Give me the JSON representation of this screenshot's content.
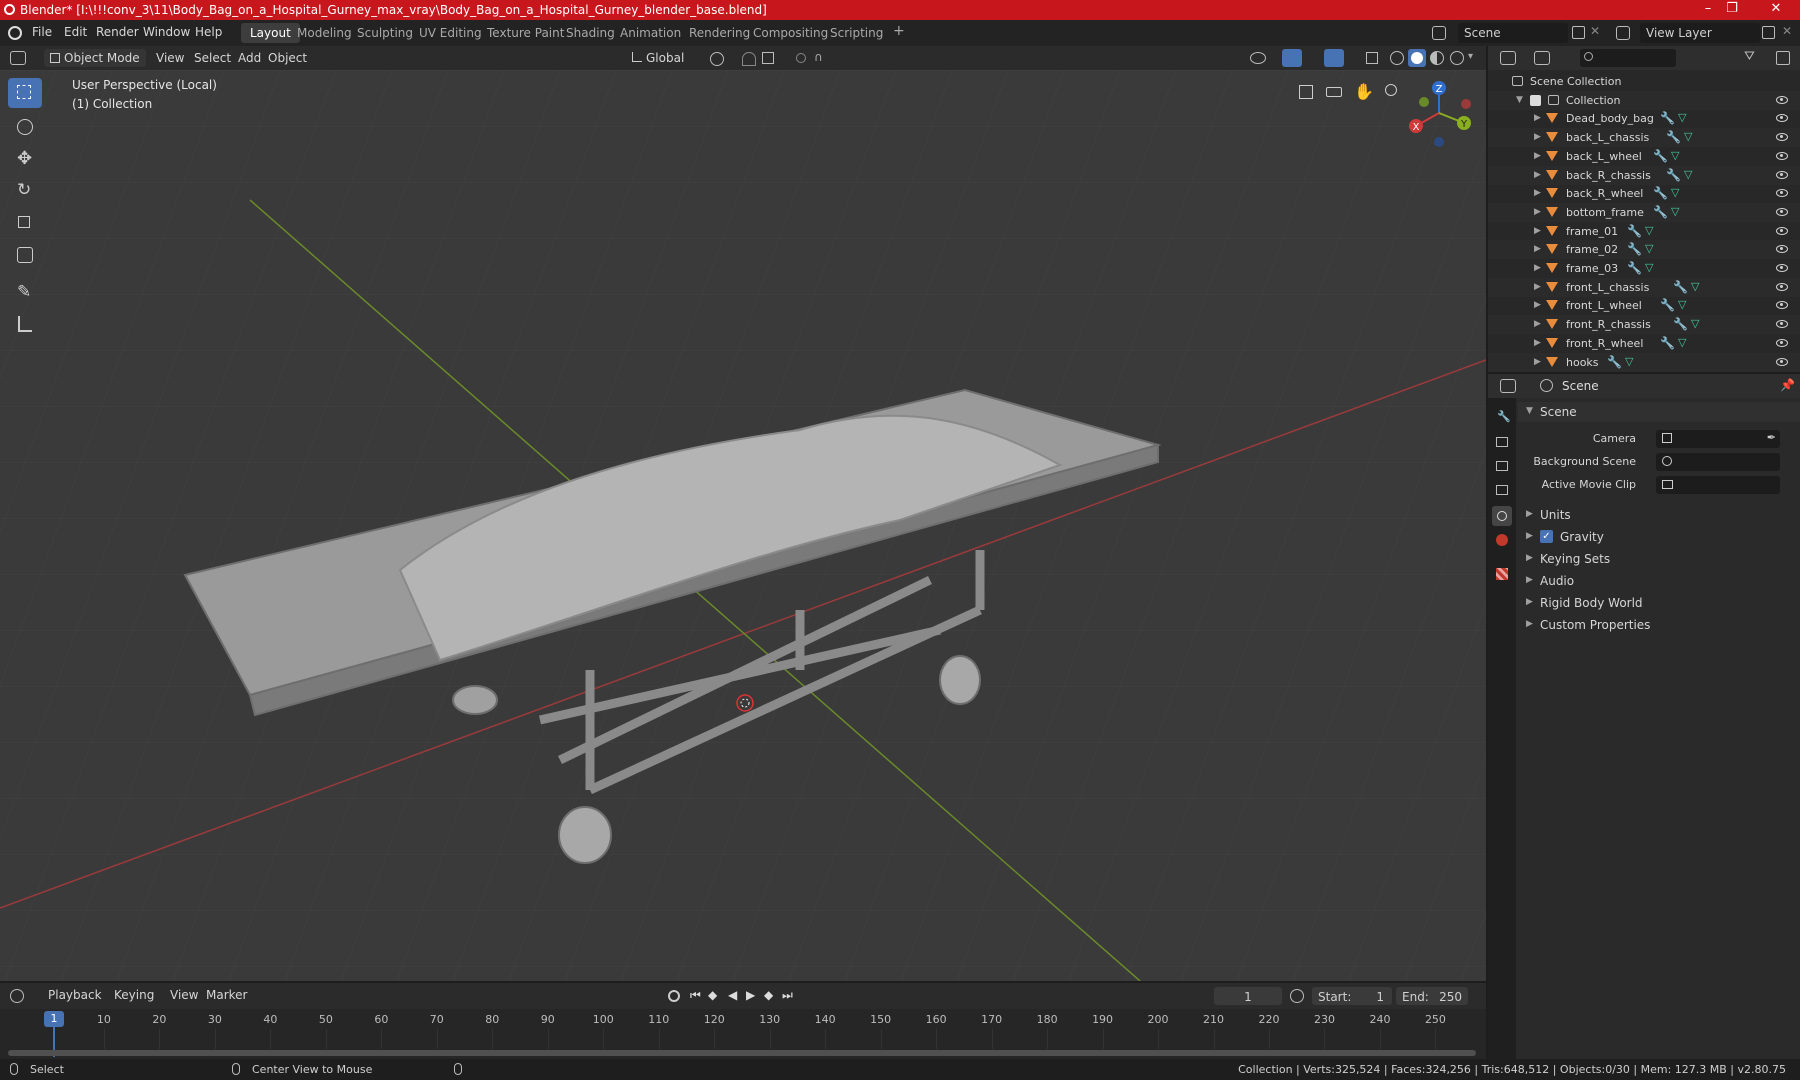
{
  "window": {
    "title": "Blender* [I:\\!!!conv_3\\11\\Body_Bag_on_a_Hospital_Gurney_max_vray\\Body_Bag_on_a_Hospital_Gurney_blender_base.blend]",
    "minimize": "–",
    "maximize": "❐",
    "close": "✕"
  },
  "menu": {
    "items": [
      "File",
      "Edit",
      "Render",
      "Window",
      "Help"
    ],
    "workspaces": [
      "Layout",
      "Modeling",
      "Sculpting",
      "UV Editing",
      "Texture Paint",
      "Shading",
      "Animation",
      "Rendering",
      "Compositing",
      "Scripting"
    ],
    "add_workspace": "+",
    "scene": "Scene",
    "view_layer": "View Layer"
  },
  "viewport_header": {
    "mode": "Object Mode",
    "menus": [
      "View",
      "Select",
      "Add",
      "Object"
    ],
    "transform_orientation": "Global"
  },
  "viewport": {
    "perspective": "User Perspective (Local)",
    "collection": "(1) Collection",
    "gizmo": {
      "x": "X",
      "y": "Y",
      "z": "Z"
    }
  },
  "outliner": {
    "search_placeholder": "",
    "root": "Scene Collection",
    "collection": "Collection",
    "objects": [
      "Dead_body_bag",
      "back_L_chassis",
      "back_L_wheel",
      "back_R_chassis",
      "back_R_wheel",
      "bottom_frame",
      "frame_01",
      "frame_02",
      "frame_03",
      "front_L_chassis",
      "front_L_wheel",
      "front_R_chassis",
      "front_R_wheel",
      "hooks"
    ]
  },
  "properties": {
    "header": "Scene",
    "panel": "Scene",
    "camera_label": "Camera",
    "background_scene_label": "Background Scene",
    "active_movie_clip_label": "Active Movie Clip",
    "sections": [
      "Units",
      "Gravity",
      "Keying Sets",
      "Audio",
      "Rigid Body World",
      "Custom Properties"
    ],
    "gravity_checked": true
  },
  "timeline": {
    "menus": [
      "Playback",
      "Keying",
      "View",
      "Marker"
    ],
    "current_frame": "1",
    "start_label": "Start:",
    "start": "1",
    "end_label": "End:",
    "end": "250",
    "ticks": [
      "1",
      "10",
      "20",
      "30",
      "40",
      "50",
      "60",
      "70",
      "80",
      "90",
      "100",
      "110",
      "120",
      "130",
      "140",
      "150",
      "160",
      "170",
      "180",
      "190",
      "200",
      "210",
      "220",
      "230",
      "240",
      "250"
    ]
  },
  "status": {
    "select": "Select",
    "center_view": "Center View to Mouse",
    "stats": "Collection | Verts:325,524 | Faces:324,256 | Tris:648,512 | Objects:0/30 | Mem: 127.3 MB | v2.80.75"
  }
}
